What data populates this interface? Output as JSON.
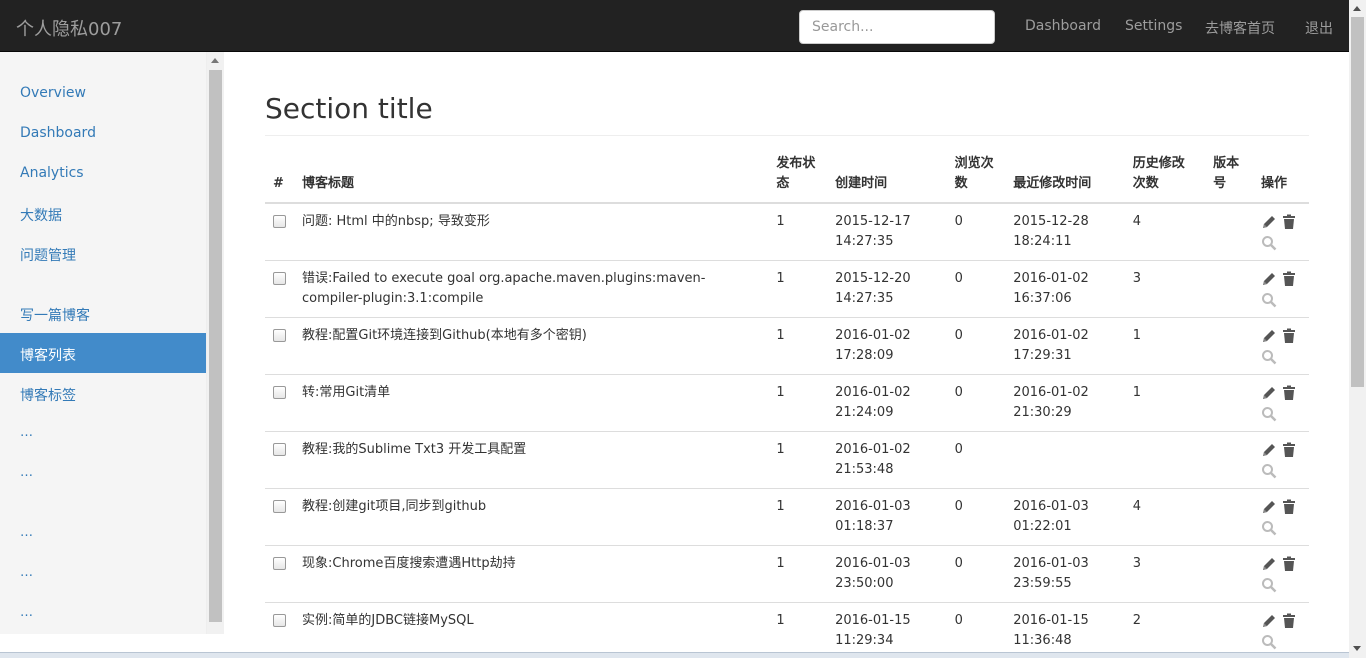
{
  "navbar": {
    "brand": "个人隐私007",
    "search_placeholder": "Search...",
    "links": [
      "Dashboard",
      "Settings",
      "去博客首页",
      "退出"
    ]
  },
  "sidebar": {
    "group1": [
      "Overview",
      "Dashboard",
      "Analytics",
      "大数据",
      "问题管理"
    ],
    "group2": [
      "写一篇博客",
      "博客列表",
      "博客标签"
    ],
    "active": "博客列表",
    "dots": "…"
  },
  "main": {
    "title": "Section title",
    "columns": [
      "#",
      "博客标题",
      "发布状态",
      "创建时间",
      "浏览次数",
      "最近修改时间",
      "历史修改次数",
      "版本号",
      "操作"
    ],
    "rows": [
      {
        "title": "问题: Html 中的nbsp; 导致变形",
        "status": "1",
        "created_date": "2015-12-17",
        "created_time": "14:27:35",
        "views": "0",
        "modified_date": "2015-12-28",
        "modified_time": "18:24:11",
        "revisions": "4",
        "version": ""
      },
      {
        "title": "错误:Failed to execute goal org.apache.maven.plugins:maven-compiler-plugin:3.1:compile",
        "status": "1",
        "created_date": "2015-12-20",
        "created_time": "14:27:35",
        "views": "0",
        "modified_date": "2016-01-02",
        "modified_time": "16:37:06",
        "revisions": "3",
        "version": ""
      },
      {
        "title": "教程:配置Git环境连接到Github(本地有多个密钥)",
        "status": "1",
        "created_date": "2016-01-02",
        "created_time": "17:28:09",
        "views": "0",
        "modified_date": "2016-01-02",
        "modified_time": "17:29:31",
        "revisions": "1",
        "version": ""
      },
      {
        "title": "转:常用Git清单",
        "status": "1",
        "created_date": "2016-01-02",
        "created_time": "21:24:09",
        "views": "0",
        "modified_date": "2016-01-02",
        "modified_time": "21:30:29",
        "revisions": "1",
        "version": ""
      },
      {
        "title": "教程:我的Sublime Txt3 开发工具配置",
        "status": "1",
        "created_date": "2016-01-02",
        "created_time": "21:53:48",
        "views": "0",
        "modified_date": "",
        "modified_time": "",
        "revisions": "",
        "version": ""
      },
      {
        "title": "教程:创建git项目,同步到github",
        "status": "1",
        "created_date": "2016-01-03",
        "created_time": "01:18:37",
        "views": "0",
        "modified_date": "2016-01-03",
        "modified_time": "01:22:01",
        "revisions": "4",
        "version": ""
      },
      {
        "title": "现象:Chrome百度搜索遭遇Http劫持",
        "status": "1",
        "created_date": "2016-01-03",
        "created_time": "23:50:00",
        "views": "0",
        "modified_date": "2016-01-03",
        "modified_time": "23:59:55",
        "revisions": "3",
        "version": ""
      },
      {
        "title": "实例:简单的JDBC链接MySQL",
        "status": "1",
        "created_date": "2016-01-15",
        "created_time": "11:29:34",
        "views": "0",
        "modified_date": "2016-01-15",
        "modified_time": "11:36:48",
        "revisions": "2",
        "version": ""
      }
    ],
    "row_icons": [
      "pencil-icon",
      "trash-icon",
      "search-icon"
    ]
  },
  "colors": {
    "navbar_bg": "#222222",
    "active_item": "#428bca",
    "link": "#337ab7",
    "icon": "#555555"
  }
}
